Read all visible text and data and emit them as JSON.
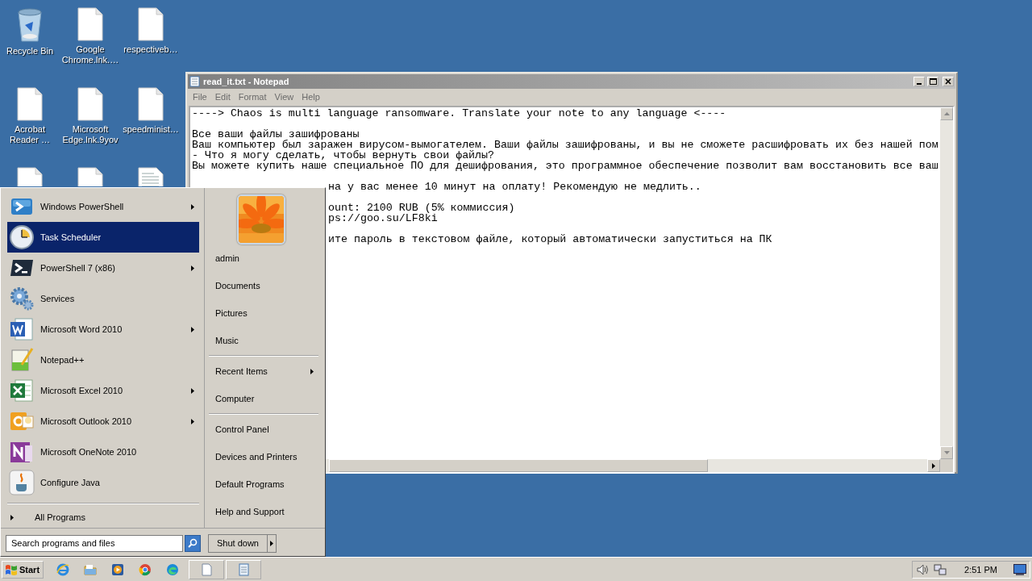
{
  "desktop": {
    "icons": [
      {
        "kind": "recycle-bin",
        "label": "Recycle Bin"
      },
      {
        "kind": "file",
        "label": "Google Chrome.lnk.…"
      },
      {
        "kind": "file",
        "label": "respectiveb…"
      },
      {
        "kind": "file",
        "label": "Acrobat Reader …"
      },
      {
        "kind": "file",
        "label": "Microsoft Edge.lnk.9yov"
      },
      {
        "kind": "file",
        "label": "speedminist…"
      },
      {
        "kind": "file"
      },
      {
        "kind": "file"
      },
      {
        "kind": "text-file"
      }
    ]
  },
  "notepad": {
    "title": "read_it.txt - Notepad",
    "menu": [
      "File",
      "Edit",
      "Format",
      "View",
      "Help"
    ],
    "paragraphs": [
      {
        "kind": "full",
        "lines": [
          "----> Chaos is multi language ransomware. Translate your note to any language <----"
        ]
      },
      {
        "kind": "full",
        "lines": [
          "Все ваши файлы зашифрованы",
          "Ваш компьютер был заражен вирусом-вымогателем. Ваши файлы зашифрованы, и вы не сможете расшифровать их без нашей пом",
          "- Что я могу сделать, чтобы вернуть свои файлы?",
          "Вы можете купить наше специальное ПО для дешифрования, это программное обеспечение позволит вам восстановить все ваш"
        ]
      },
      {
        "kind": "partial",
        "lines": [
          "на у вас менее 10 минут на оплату! Рекомендую не медлить.."
        ]
      },
      {
        "kind": "partial",
        "lines": [
          "ount: 2100 RUB (5% коммиссия)",
          "ps://goo.su/LF8ki"
        ]
      },
      {
        "kind": "partial",
        "lines": [
          "ите пароль в текстовом файле, который автоматически запуститься на ПК"
        ]
      }
    ]
  },
  "start_menu": {
    "programs": [
      {
        "kind": "powershell",
        "label": "Windows PowerShell",
        "selected": false,
        "has_submenu": true
      },
      {
        "kind": "clock",
        "label": "Task Scheduler",
        "selected": true,
        "has_submenu": false
      },
      {
        "kind": "terminal",
        "label": "PowerShell 7 (x86)",
        "selected": false,
        "has_submenu": true
      },
      {
        "kind": "gears",
        "label": "Services",
        "selected": false,
        "has_submenu": false
      },
      {
        "kind": "word",
        "label": "Microsoft Word 2010",
        "selected": false,
        "has_submenu": true
      },
      {
        "kind": "notepadpp",
        "label": "Notepad++",
        "selected": false,
        "has_submenu": false
      },
      {
        "kind": "excel",
        "label": "Microsoft Excel 2010",
        "selected": false,
        "has_submenu": true
      },
      {
        "kind": "outlook",
        "label": "Microsoft Outlook 2010",
        "selected": false,
        "has_submenu": true
      },
      {
        "kind": "onenote",
        "label": "Microsoft OneNote 2010",
        "selected": false,
        "has_submenu": false
      },
      {
        "kind": "java",
        "label": "Configure Java",
        "selected": false,
        "has_submenu": false
      }
    ],
    "all_programs": "All Programs",
    "places": [
      [
        {
          "label": "admin",
          "has_submenu": false
        },
        {
          "label": "Documents",
          "has_submenu": false
        },
        {
          "label": "Pictures",
          "has_submenu": false
        },
        {
          "label": "Music",
          "has_submenu": false
        }
      ],
      [
        {
          "label": "Recent Items",
          "has_submenu": true
        },
        {
          "label": "Computer",
          "has_submenu": false
        }
      ],
      [
        {
          "label": "Control Panel",
          "has_submenu": false
        },
        {
          "label": "Devices and Printers",
          "has_submenu": false
        },
        {
          "label": "Default Programs",
          "has_submenu": false
        },
        {
          "label": "Help and Support",
          "has_submenu": false
        }
      ]
    ],
    "search": {
      "placeholder": "Search programs and files"
    },
    "shutdown": "Shut down"
  },
  "taskbar": {
    "start": "Start",
    "apps": [
      {
        "kind": "ie",
        "running": false
      },
      {
        "kind": "folder",
        "running": false
      },
      {
        "kind": "media",
        "running": false
      },
      {
        "kind": "chrome",
        "running": false
      },
      {
        "kind": "edge",
        "running": false
      },
      {
        "kind": "document",
        "running": true
      },
      {
        "kind": "notepad",
        "running": true
      }
    ],
    "clock": "2:51 PM"
  }
}
